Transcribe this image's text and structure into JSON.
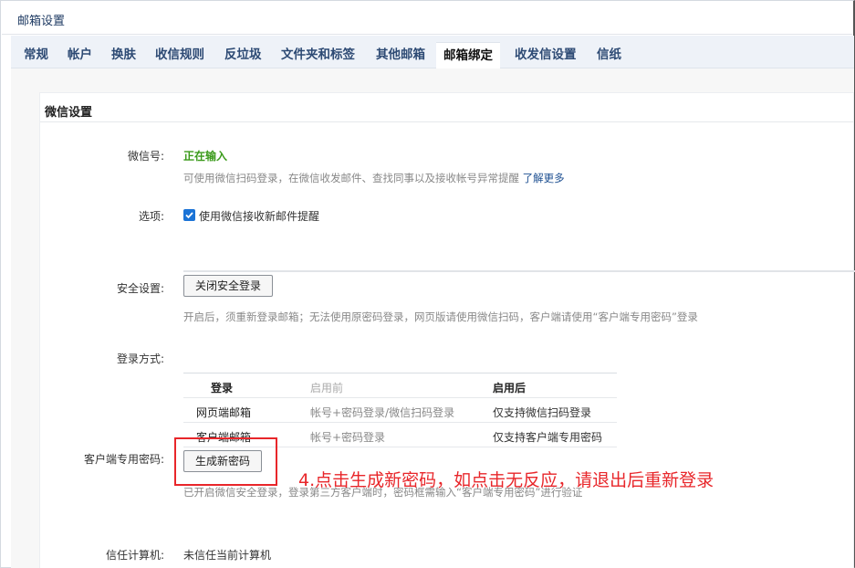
{
  "window": {
    "title": "邮箱设置"
  },
  "tabs": [
    {
      "label": "常规",
      "active": false
    },
    {
      "label": "帐户",
      "active": false
    },
    {
      "label": "换肤",
      "active": false
    },
    {
      "label": "收信规则",
      "active": false
    },
    {
      "label": "反垃圾",
      "active": false
    },
    {
      "label": "文件夹和标签",
      "active": false
    },
    {
      "label": "其他邮箱",
      "active": false
    },
    {
      "label": "邮箱绑定",
      "active": true
    },
    {
      "label": "收发信设置",
      "active": false
    },
    {
      "label": "信纸",
      "active": false
    }
  ],
  "section": {
    "title": "微信设置"
  },
  "wechat": {
    "label": "微信号:",
    "status": "正在输入",
    "hint": "可使用微信扫码登录，在微信收发邮件、查找同事以及接收帐号异常提醒",
    "learn_more": "了解更多"
  },
  "options": {
    "label": "选项:",
    "checkbox_label": "使用微信接收新邮件提醒",
    "checked": true
  },
  "security": {
    "label": "安全设置:",
    "button": "关闭安全登录",
    "hint": "开启后，须重新登录邮箱；无法使用原密码登录，网页版请使用微信扫码，客户端请使用“客户端专用密码”登录"
  },
  "login_method": {
    "label": "登录方式:",
    "headers": [
      "登录",
      "启用前",
      "启用后"
    ],
    "rows": [
      [
        "网页端邮箱",
        "帐号+密码登录/微信扫码登录",
        "仅支持微信扫码登录"
      ],
      [
        "客户端邮箱",
        "帐号+密码登录",
        "仅支持客户端专用密码"
      ]
    ]
  },
  "client_password": {
    "label": "客户端专用密码:",
    "button": "生成新密码",
    "hint": "已开启微信安全登录，登录第三方客户端时，密码框需输入“客户端专用密码”进行验证"
  },
  "trusted": {
    "label": "信任计算机:",
    "value": "未信任当前计算机"
  },
  "annotation": {
    "text": "4.点击生成新密码，如点击无反应，请退出后重新登录"
  },
  "colors": {
    "accent": "#1a73d6",
    "annotation": "#e8262a",
    "status_green": "#3a9a1a"
  }
}
